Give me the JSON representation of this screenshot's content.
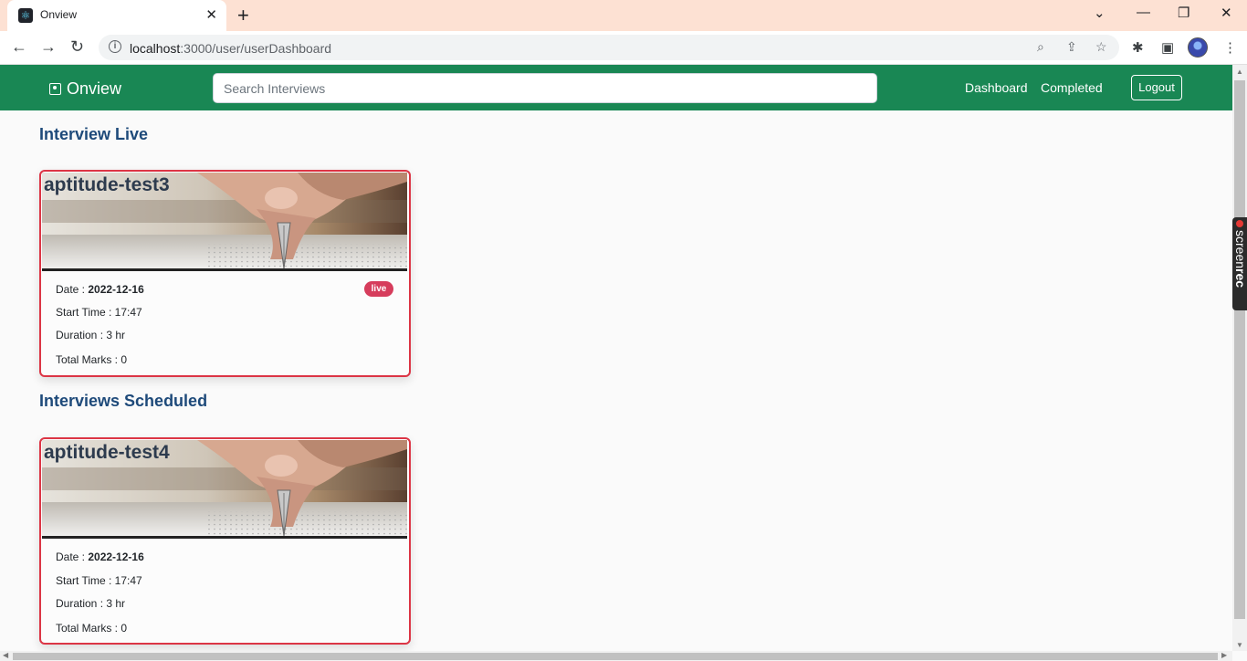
{
  "browser": {
    "tab_title": "Onview",
    "url_host": "localhost",
    "url_rest": ":3000/user/userDashboard"
  },
  "navbar": {
    "brand": "Onview",
    "search_placeholder": "Search Interviews",
    "links": [
      "Dashboard",
      "Completed"
    ],
    "logout": "Logout",
    "color": "#198754"
  },
  "sections": {
    "live": {
      "title": "Interview Live",
      "card": {
        "name": "aptitude-test3",
        "date_label": "Date : ",
        "date": "2022-12-16",
        "start": "Start Time : 17:47",
        "duration": "Duration : 3 hr",
        "marks": "Total Marks : 0",
        "badge": "live"
      }
    },
    "scheduled": {
      "title": "Interviews Scheduled",
      "card": {
        "name": "aptitude-test4",
        "date_label": "Date : ",
        "date": "2022-12-16",
        "start": "Start Time : 17:47",
        "duration": "Duration : 3 hr",
        "marks": "Total Marks : 0"
      }
    }
  },
  "widgets": {
    "screenrec_light": "screen",
    "screenrec_bold": "rec"
  },
  "colors": {
    "card_border": "#dc3545",
    "badge": "#d63d5c",
    "heading": "#1e4a7a"
  }
}
